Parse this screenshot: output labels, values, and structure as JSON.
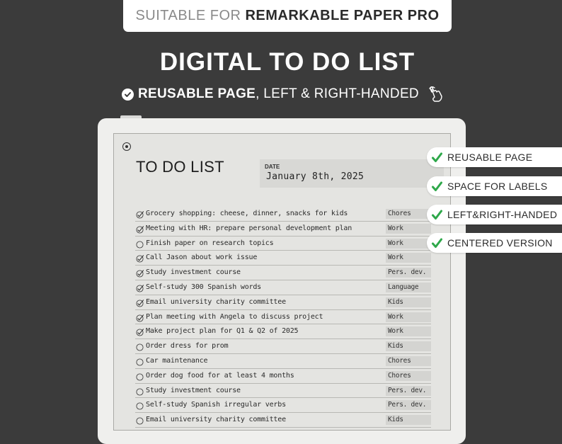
{
  "banner": {
    "prefix": "SUITABLE FOR",
    "product": "REMARKABLE PAPER PRO"
  },
  "headline": "DIGITAL TO DO LIST",
  "subline": {
    "bold": "REUSABLE PAGE",
    "rest": ", LEFT & RIGHT-HANDED"
  },
  "features": [
    "REUSABLE PAGE",
    "SPACE FOR LABELS",
    "LEFT&RIGHT-HANDED",
    "CENTERED VERSION"
  ],
  "page": {
    "title": "TO DO LIST",
    "date_label": "DATE",
    "date_value": "January 8th, 2025"
  },
  "tasks": [
    {
      "text": "Grocery shopping: cheese, dinner, snacks for kids",
      "label": "Chores",
      "done": true
    },
    {
      "text": "Meeting with HR: prepare personal development plan",
      "label": "Work",
      "done": true
    },
    {
      "text": "Finish paper on research topics",
      "label": "Work",
      "done": false
    },
    {
      "text": "Call Jason about work issue",
      "label": "Work",
      "done": true
    },
    {
      "text": "Study investment course",
      "label": "Pers. dev.",
      "done": true
    },
    {
      "text": "Self-study 300 Spanish words",
      "label": "Language",
      "done": true
    },
    {
      "text": "Email university charity committee",
      "label": "Kids",
      "done": true
    },
    {
      "text": "Plan meeting with Angela to discuss project",
      "label": "Work",
      "done": true
    },
    {
      "text": "Make project plan for Q1 & Q2 of 2025",
      "label": "Work",
      "done": true
    },
    {
      "text": "Order dress for prom",
      "label": "Kids",
      "done": false
    },
    {
      "text": "Car maintenance",
      "label": "Chores",
      "done": false
    },
    {
      "text": "Order dog food for at least 4 months",
      "label": "Chores",
      "done": false
    },
    {
      "text": "Study investment course",
      "label": "Pers. dev.",
      "done": false
    },
    {
      "text": "Self-study Spanish irregular verbs",
      "label": "Pers. dev.",
      "done": false
    },
    {
      "text": "Email university charity committee",
      "label": "Kids",
      "done": false
    }
  ],
  "colors": {
    "background": "#3b3b3b",
    "check_green": "#2ea84a",
    "device": "#efefed",
    "screen": "#e4e4e1"
  }
}
